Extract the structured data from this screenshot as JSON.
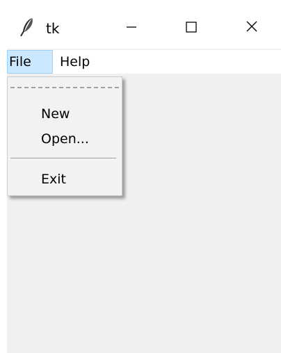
{
  "window": {
    "title": "tk",
    "controls": {
      "minimize_icon": "minimize-icon",
      "maximize_icon": "maximize-icon",
      "close_icon": "close-icon"
    }
  },
  "menubar": {
    "items": [
      {
        "label": "File",
        "active": true
      },
      {
        "label": "Help",
        "active": false
      }
    ]
  },
  "file_menu": {
    "items": [
      {
        "label": "New"
      },
      {
        "label": "Open..."
      },
      {
        "label": "Exit"
      }
    ]
  },
  "colors": {
    "menu_active_bg": "#cce8ff",
    "menu_active_border": "#99d1ff",
    "client_bg": "#f0f0f0",
    "dropdown_bg": "#f2f2f2"
  }
}
